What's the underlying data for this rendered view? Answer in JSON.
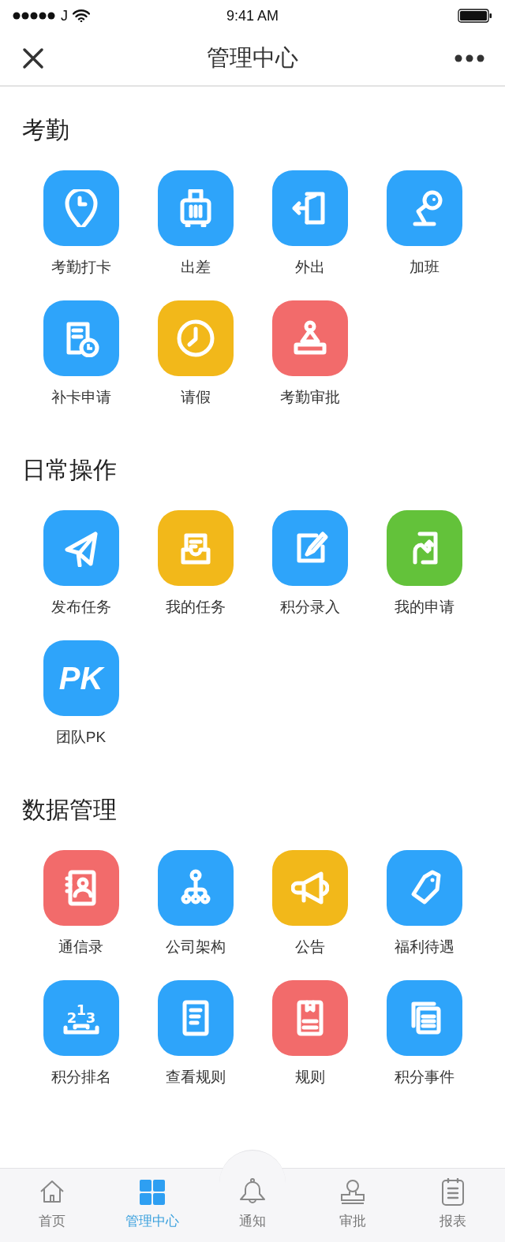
{
  "status_bar": {
    "carrier": "J",
    "time": "9:41 AM"
  },
  "nav_bar": {
    "title": "管理中心"
  },
  "sections": [
    {
      "title": "考勤",
      "items": [
        {
          "label": "考勤打卡",
          "color": "#2ea4fa"
        },
        {
          "label": "出差",
          "color": "#2ea4fa"
        },
        {
          "label": "外出",
          "color": "#2ea4fa"
        },
        {
          "label": "加班",
          "color": "#2ea4fa"
        },
        {
          "label": "补卡申请",
          "color": "#2ea4fa"
        },
        {
          "label": "请假",
          "color": "#f2b81a"
        },
        {
          "label": "考勤审批",
          "color": "#f26b6b"
        }
      ]
    },
    {
      "title": "日常操作",
      "items": [
        {
          "label": "发布任务",
          "color": "#2ea4fa"
        },
        {
          "label": "我的任务",
          "color": "#f2b81a"
        },
        {
          "label": "积分录入",
          "color": "#2ea4fa"
        },
        {
          "label": "我的申请",
          "color": "#63c23a"
        },
        {
          "label": "团队PK",
          "color": "#2ea4fa",
          "icon_text": [
            "PK"
          ]
        }
      ]
    },
    {
      "title": "数据管理",
      "items": [
        {
          "label": "通信录",
          "color": "#f26b6b"
        },
        {
          "label": "公司架构",
          "color": "#2ea4fa"
        },
        {
          "label": "公告",
          "color": "#f2b81a"
        },
        {
          "label": "福利待遇",
          "color": "#2ea4fa"
        },
        {
          "label": "积分排名",
          "color": "#2ea4fa",
          "icon_text": [
            "2",
            "1",
            "3"
          ]
        },
        {
          "label": "查看规则",
          "color": "#2ea4fa"
        },
        {
          "label": "规则",
          "color": "#f26b6b"
        },
        {
          "label": "积分事件",
          "color": "#2ea4fa"
        }
      ]
    }
  ],
  "tab_bar": [
    {
      "label": "首页",
      "selected": false
    },
    {
      "label": "管理中心",
      "selected": true
    },
    {
      "label": "通知",
      "selected": false
    },
    {
      "label": "审批",
      "selected": false
    },
    {
      "label": "报表",
      "selected": false
    }
  ]
}
